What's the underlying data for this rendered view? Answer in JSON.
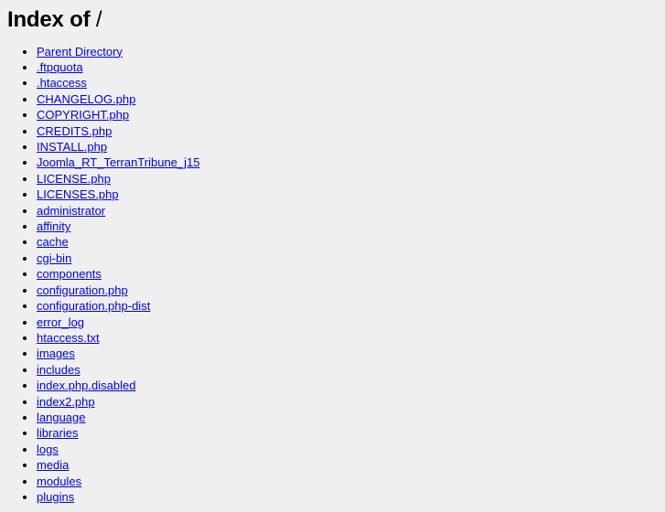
{
  "page": {
    "title_prefix": "Index of",
    "path": "/",
    "background_color": "#efefef",
    "link_color": "#0000ee",
    "text_color": "#000000"
  },
  "listing": {
    "items": [
      {
        "label": "Parent Directory"
      },
      {
        "label": ".ftpquota"
      },
      {
        "label": ".htaccess"
      },
      {
        "label": "CHANGELOG.php"
      },
      {
        "label": "COPYRIGHT.php"
      },
      {
        "label": "CREDITS.php"
      },
      {
        "label": "INSTALL.php"
      },
      {
        "label": "Joomla_RT_TerranTribune_j15"
      },
      {
        "label": "LICENSE.php"
      },
      {
        "label": "LICENSES.php"
      },
      {
        "label": "administrator"
      },
      {
        "label": "affinity"
      },
      {
        "label": "cache"
      },
      {
        "label": "cgi-bin"
      },
      {
        "label": "components"
      },
      {
        "label": "configuration.php"
      },
      {
        "label": "configuration.php-dist"
      },
      {
        "label": "error_log"
      },
      {
        "label": "htaccess.txt"
      },
      {
        "label": "images"
      },
      {
        "label": "includes"
      },
      {
        "label": "index.php.disabled"
      },
      {
        "label": "index2.php"
      },
      {
        "label": "language"
      },
      {
        "label": "libraries"
      },
      {
        "label": "logs"
      },
      {
        "label": "media"
      },
      {
        "label": "modules"
      },
      {
        "label": "plugins"
      }
    ]
  }
}
